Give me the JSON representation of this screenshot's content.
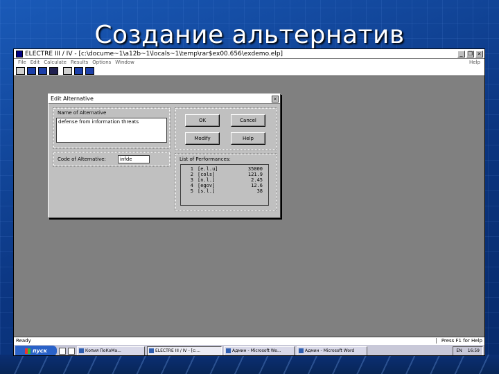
{
  "slide": {
    "title": "Создание альтернатив"
  },
  "app": {
    "title": "ELECTRE III / IV - [c:\\docume~1\\a12b~1\\locals~1\\temp\\rar$ex00.656\\exdemo.elp]",
    "window_buttons": {
      "minimize": "_",
      "restore": "❐",
      "close": "×"
    },
    "doc_buttons": {
      "minimize": "_",
      "close": "×"
    },
    "menu": [
      "File",
      "Edit",
      "Calculate",
      "Results",
      "Options",
      "Window"
    ],
    "menu_help": "Help",
    "toolbar_icons": [
      "new-file-icon",
      "import-icon",
      "export-icon",
      "print-icon",
      "criteria-icon",
      "alternatives-icon",
      "table-icon"
    ]
  },
  "dialog": {
    "title": "Edit  Alternative",
    "close": "×",
    "name_label": "Name of Alternative",
    "name_value": "defense from information threats",
    "code_label": "Code of Alternative:",
    "code_value": "infde",
    "ok_label": "OK",
    "cancel_label": "Cancel",
    "modify_label": "Modify",
    "help_label": "Help",
    "performances_label": "List of Performances:",
    "performances": [
      {
        "idx": "1",
        "crit": "[e.l.u]",
        "value": "35000"
      },
      {
        "idx": "2",
        "crit": "[cols]",
        "value": "121.9"
      },
      {
        "idx": "3",
        "crit": "[n.l.]",
        "value": "2.45"
      },
      {
        "idx": "4",
        "crit": "[egov]",
        "value": "12.6"
      },
      {
        "idx": "5",
        "crit": "[s.l.]",
        "value": "38"
      }
    ]
  },
  "status": {
    "left": "Ready",
    "right": "Press F1 for Help"
  },
  "taskbar": {
    "start": "пуск",
    "tasks": [
      "Копия ПоКoMa...",
      "ELECTRE III / IV - [c:...",
      "Админ - Microsoft Wo...",
      "Админ - Microsoft Word"
    ],
    "lang": "EN",
    "clock": "16:59"
  }
}
